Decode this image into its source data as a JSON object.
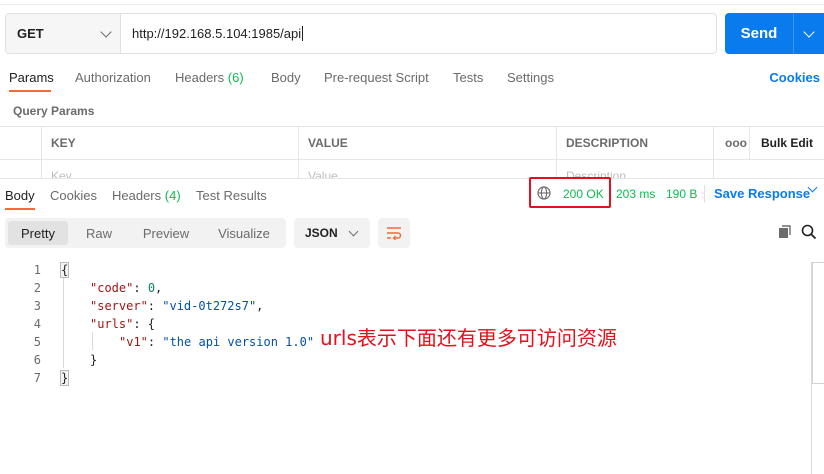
{
  "request": {
    "method": "GET",
    "url": "http://192.168.5.104:1985/api",
    "send_label": "Send"
  },
  "request_tabs": [
    {
      "label": "Params",
      "count": ""
    },
    {
      "label": "Authorization",
      "count": ""
    },
    {
      "label": "Headers",
      "count": "(6)"
    },
    {
      "label": "Body",
      "count": ""
    },
    {
      "label": "Pre-request Script",
      "count": ""
    },
    {
      "label": "Tests",
      "count": ""
    },
    {
      "label": "Settings",
      "count": ""
    }
  ],
  "cookies_link": "Cookies",
  "query_params": {
    "title": "Query Params",
    "headers": [
      "KEY",
      "VALUE",
      "DESCRIPTION"
    ],
    "more_icon": "ooo",
    "bulk_edit": "Bulk Edit",
    "placeholders": [
      "Key",
      "Value",
      "Description"
    ]
  },
  "response_tabs": [
    {
      "label": "Body",
      "count": ""
    },
    {
      "label": "Cookies",
      "count": ""
    },
    {
      "label": "Headers",
      "count": "(4)"
    },
    {
      "label": "Test Results",
      "count": ""
    }
  ],
  "response_meta": {
    "status": "200 OK",
    "time": "203 ms",
    "size": "190 B",
    "save_response": "Save Response"
  },
  "view_modes": [
    "Pretty",
    "Raw",
    "Preview",
    "Visualize"
  ],
  "format": "JSON",
  "code_lines": [
    {
      "n": "1",
      "text": "{"
    },
    {
      "n": "2",
      "text": "\"code\": 0,"
    },
    {
      "n": "3",
      "text": "\"server\": \"vid-0t272s7\","
    },
    {
      "n": "4",
      "text": "\"urls\": {"
    },
    {
      "n": "5",
      "text": "\"v1\": \"the api version 1.0\""
    },
    {
      "n": "6",
      "text": "}"
    },
    {
      "n": "7",
      "text": "}"
    }
  ],
  "json_tokens": {
    "code_key": "\"code\"",
    "code_val": "0",
    "server_key": "\"server\"",
    "server_val": "\"vid-0t272s7\"",
    "urls_key": "\"urls\"",
    "v1_key": "\"v1\"",
    "v1_val": "\"the api version 1.0\""
  },
  "annotation": "urls表示下面还有更多可访问资源",
  "colors": {
    "accent": "#097bed",
    "active_tab": "#f26b3a",
    "success": "#0cbb52",
    "highlight_box": "#e3111b"
  }
}
